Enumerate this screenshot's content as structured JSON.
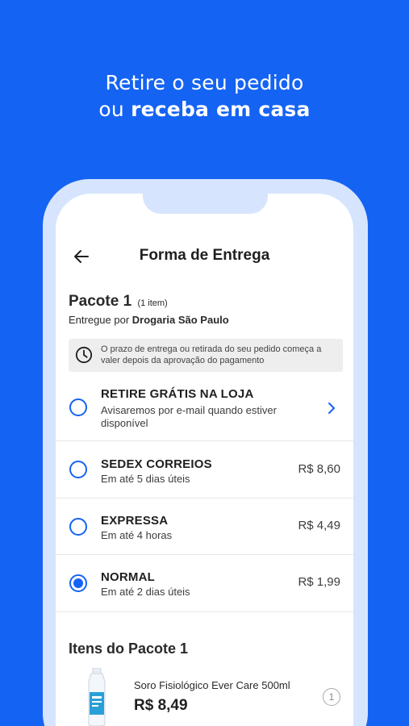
{
  "headline": {
    "line1": "Retire o seu pedido",
    "line2_prefix": "ou ",
    "line2_bold": "receba em casa"
  },
  "header": {
    "title": "Forma de Entrega",
    "back_icon": "arrow-left-icon"
  },
  "package": {
    "title": "Pacote 1",
    "count": "(1 item)",
    "seller_prefix": "Entregue por ",
    "seller_name": "Drogaria São Paulo",
    "notice": "O prazo de entrega ou retirada do seu pedido começa a valer depois da aprovação do pagamento",
    "notice_icon": "clock-icon"
  },
  "options": [
    {
      "title": "RETIRE GRÁTIS NA LOJA",
      "subtitle": "Avisaremos por e-mail quando estiver disponível",
      "price": "",
      "selected": false
    },
    {
      "title": "SEDEX CORREIOS",
      "subtitle": "Em até 5 dias úteis",
      "price": "R$ 8,60",
      "selected": false
    },
    {
      "title": "EXPRESSA",
      "subtitle": "Em até 4 horas",
      "price": "R$ 4,49",
      "selected": false
    },
    {
      "title": "NORMAL",
      "subtitle": "Em até 2 dias úteis",
      "price": "R$ 1,99",
      "selected": true
    }
  ],
  "items": {
    "title": "Itens do Pacote 1",
    "products": [
      {
        "name": "Soro Fisiológico Ever Care 500ml",
        "price": "R$ 8,49",
        "quantity": "1"
      }
    ]
  },
  "colors": {
    "brand_blue": "#1463f3",
    "frame": "#d6e5fd"
  }
}
